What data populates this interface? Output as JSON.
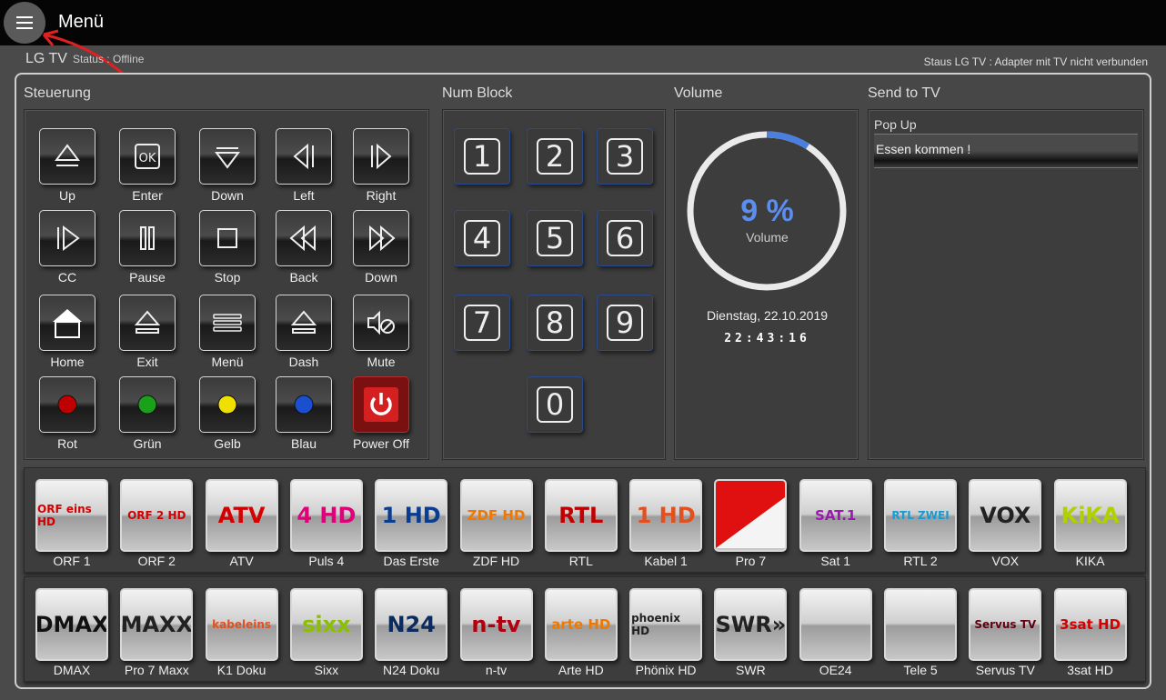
{
  "header": {
    "menu_label": "Menü"
  },
  "device": {
    "title": "LG TV",
    "status": "Status : Offline",
    "status_right": "Staus LG TV : Adapter mit TV nicht verbunden"
  },
  "sections": {
    "steuerung": "Steuerung",
    "numblock": "Num Block",
    "volume": "Volume",
    "send": "Send to TV"
  },
  "controls": [
    {
      "label": "Up",
      "icon": "triangle-up-icon"
    },
    {
      "label": "Enter",
      "icon": "ok-icon"
    },
    {
      "label": "Down",
      "icon": "triangle-down-icon"
    },
    {
      "label": "Left",
      "icon": "triangle-left-icon"
    },
    {
      "label": "Right",
      "icon": "triangle-right-icon"
    },
    {
      "label": "CC",
      "icon": "play-icon"
    },
    {
      "label": "Pause",
      "icon": "pause-icon"
    },
    {
      "label": "Stop",
      "icon": "stop-icon"
    },
    {
      "label": "Back",
      "icon": "rewind-icon"
    },
    {
      "label": "Down",
      "icon": "fast-forward-icon"
    },
    {
      "label": "Home",
      "icon": "home-icon"
    },
    {
      "label": "Exit",
      "icon": "eject-icon"
    },
    {
      "label": "Menü",
      "icon": "menu-icon"
    },
    {
      "label": "Dash",
      "icon": "eject-icon"
    },
    {
      "label": "Mute",
      "icon": "mute-icon"
    },
    {
      "label": "Rot",
      "icon": "red-dot-icon",
      "color": "#c00000"
    },
    {
      "label": "Grün",
      "icon": "green-dot-icon",
      "color": "#1aa01a"
    },
    {
      "label": "Gelb",
      "icon": "yellow-dot-icon",
      "color": "#f0e000"
    },
    {
      "label": "Blau",
      "icon": "blue-dot-icon",
      "color": "#1a4fd0"
    },
    {
      "label": "Power Off",
      "icon": "power-icon",
      "color": "#d42020"
    }
  ],
  "numpad": [
    "1",
    "2",
    "3",
    "4",
    "5",
    "6",
    "7",
    "8",
    "9",
    "0"
  ],
  "volume": {
    "value": "9 %",
    "label": "Volume",
    "level": 0.09,
    "accent": "#4a7fe0",
    "date": "Dienstag, 22.10.2019",
    "time": "22:43:16"
  },
  "send": {
    "popup_label": "Pop Up",
    "popup_value": "Essen kommen !"
  },
  "channels_row1": [
    {
      "name": "ORF 1",
      "logo": "ORF eins HD",
      "color": "#d40000"
    },
    {
      "name": "ORF 2",
      "logo": "ORF 2 HD",
      "color": "#d40000"
    },
    {
      "name": "ATV",
      "logo": "ATV",
      "color": "#d40000"
    },
    {
      "name": "Puls 4",
      "logo": "4 HD",
      "color": "#e0007a"
    },
    {
      "name": "Das Erste",
      "logo": "1 HD",
      "color": "#0a3d8f"
    },
    {
      "name": "ZDF HD",
      "logo": "ZDF HD",
      "color": "#f07800"
    },
    {
      "name": "RTL",
      "logo": "RTL",
      "color": "#c00000"
    },
    {
      "name": "Kabel 1",
      "logo": "1 HD",
      "color": "#e05020"
    },
    {
      "name": "Pro 7",
      "logo": "",
      "color": "#e01010"
    },
    {
      "name": "Sat 1",
      "logo": "SAT.1",
      "color": "#9a1ab0"
    },
    {
      "name": "RTL 2",
      "logo": "RTL ZWEI",
      "color": "#1a9ad0"
    },
    {
      "name": "VOX",
      "logo": "VOX",
      "color": "#222222"
    },
    {
      "name": "KIKA",
      "logo": "KiKA",
      "color": "#b0d000"
    }
  ],
  "channels_row2": [
    {
      "name": "DMAX",
      "logo": "DMAX",
      "color": "#111111"
    },
    {
      "name": "Pro 7 Maxx",
      "logo": "MAXX",
      "color": "#222222"
    },
    {
      "name": "K1 Doku",
      "logo": "kabeleins",
      "color": "#e05020"
    },
    {
      "name": "Sixx",
      "logo": "sixx",
      "color": "#8ac000"
    },
    {
      "name": "N24 Doku",
      "logo": "N24",
      "color": "#0a2a60"
    },
    {
      "name": "n-tv",
      "logo": "n-tv",
      "color": "#b00010"
    },
    {
      "name": "Arte HD",
      "logo": "arte HD",
      "color": "#f07800"
    },
    {
      "name": "Phönix HD",
      "logo": "phoenix HD",
      "color": "#222222"
    },
    {
      "name": "SWR",
      "logo": "SWR»",
      "color": "#222222"
    },
    {
      "name": "OE24",
      "logo": "",
      "color": "#cccccc"
    },
    {
      "name": "Tele 5",
      "logo": "",
      "color": "#cccccc"
    },
    {
      "name": "Servus TV",
      "logo": "Servus TV",
      "color": "#600010"
    },
    {
      "name": "3sat HD",
      "logo": "3sat HD",
      "color": "#d40000"
    }
  ]
}
